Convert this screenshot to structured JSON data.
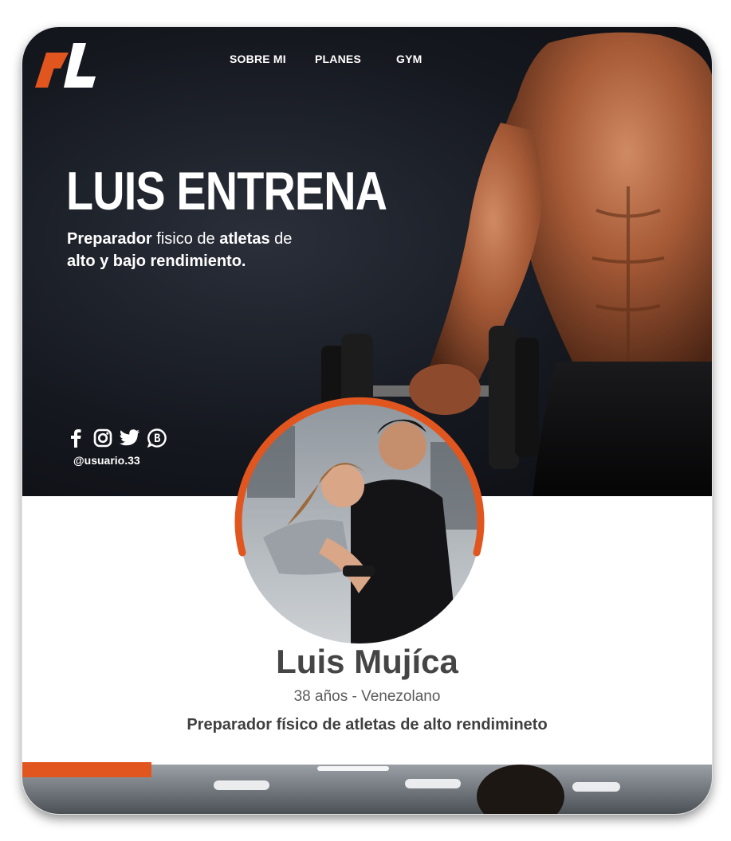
{
  "brand": {
    "logo_icon": "ml-monogram-logo",
    "accent_color": "#e1561f"
  },
  "nav": {
    "items": [
      "SOBRE MI",
      "PLANES",
      "GYM"
    ]
  },
  "hero": {
    "title": "LUIS ENTRENA",
    "subtitle": {
      "w1": "Preparador",
      "w2": " fisico de ",
      "w3": "atletas",
      "w4": " de",
      "line2": "alto y bajo  rendimiento."
    }
  },
  "social": {
    "icons": [
      "facebook-icon",
      "instagram-icon",
      "twitter-icon",
      "whatsapp-icon"
    ],
    "handle": "@usuario.33"
  },
  "profile": {
    "name": "Luis Mujíca",
    "age_nationality": "38 años - Venezolano",
    "description": "Preparador físico de atletas de alto rendimineto"
  }
}
